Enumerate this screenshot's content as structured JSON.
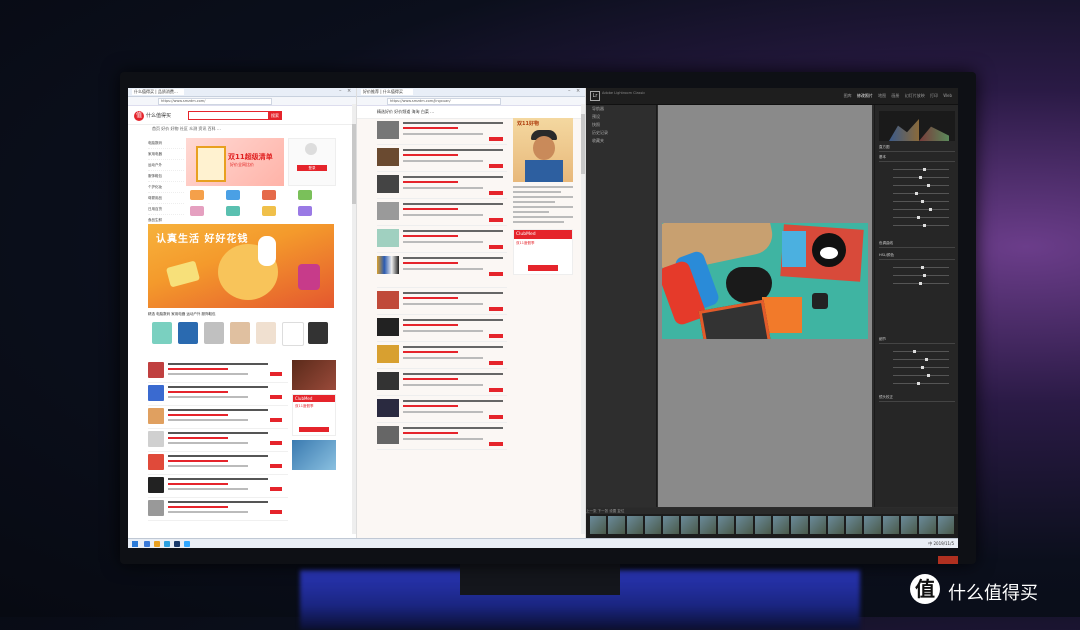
{
  "browser_left": {
    "tab_title": "什么值得买 | 品质消费…",
    "url": "https://www.smzdm.com/",
    "site_name": "什么值得买",
    "search_btn": "搜索",
    "nav": "首页  好价  好物  社区  众测  资讯  百科  …",
    "menu": [
      "电脑数码",
      "家用电器",
      "运动户外",
      "服饰鞋包",
      "个护化妆",
      "母婴用品",
      "日用百货",
      "食品生鲜",
      "礼品钟表",
      "图书音像",
      "玩模乐器",
      "办公设备",
      "家居家装",
      "汽车消费"
    ],
    "promo_title": "双11超级清单",
    "promo_sub": "好价全网比价",
    "login_btn": "登录",
    "banner_title": "认真生活 好好花钱",
    "tabs": "精选  电脑数码  家用电器  运动户外  服饰鞋包",
    "ad_club_head": "ClubMed",
    "ad_club_text": "双11度假季"
  },
  "browser_mid": {
    "tab_title": "好价推荐 | 什么值得买",
    "url": "https://www.smzdm.com/jingxuan/",
    "head": "精选好价  好价频道  海淘  白菜  …",
    "kid_text": "双11好物",
    "club_head": "ClubMed",
    "club_text": "双11度假季"
  },
  "lightroom": {
    "logo": "Lr",
    "catalog": "Adobe Lightroom Classic",
    "modules": [
      "图库",
      "修改照片",
      "地图",
      "画册",
      "幻灯片放映",
      "打印",
      "Web"
    ],
    "active_module": "修改照片",
    "left_panels": [
      "导航器",
      "预设",
      "快照",
      "历史记录",
      "收藏夹"
    ],
    "right_panels": [
      "直方图",
      "基本",
      "色调曲线",
      "HSL/颜色",
      "细节",
      "镜头校正"
    ],
    "toolbar_text": "上一张  下一张  设置  复位"
  },
  "taskbar": {
    "tray": "中  2019/11/5"
  },
  "watermark": {
    "icon": "值",
    "text": "什么值得买"
  }
}
